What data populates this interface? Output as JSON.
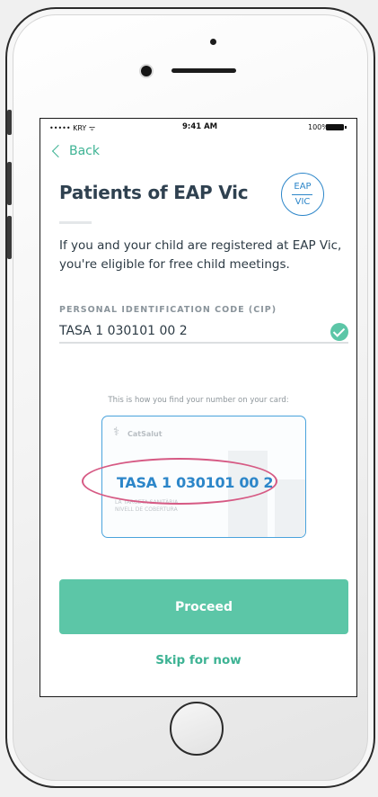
{
  "statusbar": {
    "carrier": "••••• KRY ᯤ",
    "time": "9:41 AM",
    "battery": "100%"
  },
  "nav": {
    "back_label": "Back"
  },
  "header": {
    "title": "Patients of EAP Vic",
    "badge_top": "EAP",
    "badge_bottom": "VIC"
  },
  "intro": {
    "text": "If you and your child are registered at EAP Vic, you're eligible for free child meetings."
  },
  "cip_field": {
    "label": "PERSONAL IDENTIFICATION CODE (CIP)",
    "value": "TASA 1 030101 00 2",
    "valid": true
  },
  "card_hint": {
    "caption": "This is how you find your number on your card:",
    "brand": "CatSalut",
    "code": "TASA 1 030101 00 2",
    "subtext_line1": "LA TARGETA SANITÀRIA",
    "subtext_line2": "NIVELL DE COBERTURA"
  },
  "actions": {
    "proceed_label": "Proceed",
    "skip_label": "Skip for now"
  },
  "colors": {
    "accent_green": "#5cc6a7",
    "link_green": "#3eb394",
    "title_navy": "#2f4150",
    "badge_blue": "#2c86c9",
    "highlight_pink": "#d65a84"
  }
}
